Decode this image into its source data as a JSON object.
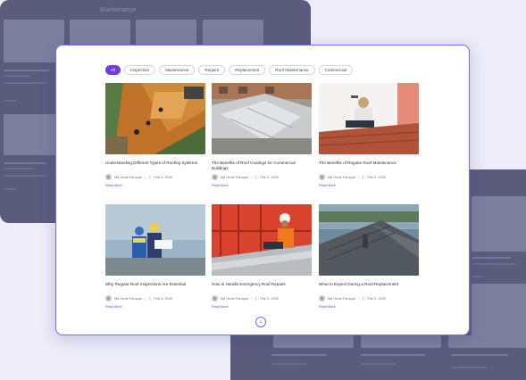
{
  "background": {
    "left_title": "Maintenance",
    "left_posts": [
      {
        "title": "Understanding Different Types of Roofing Systems"
      },
      {
        "title": "What to Expect During a Roof Replacement"
      }
    ],
    "right_posts": [
      {
        "title": "Understanding Different Types of Roofing Systems"
      },
      {
        "title": "The Benefits of Roof Coatings for Commercial Buildings"
      },
      {
        "title": "The Benefits of Regular Roof Maintenance"
      }
    ]
  },
  "filters": [
    "All",
    "Inspection",
    "Maintenance",
    "Repairs",
    "Replacement",
    "Roof Maintenance",
    "Commercial"
  ],
  "active_filter": "All",
  "posts": [
    {
      "title": "Understanding Different Types of Roofing Systems",
      "author": "Md Omar Faruque",
      "date": "Feb 3, 2025",
      "link": "Read More",
      "image": "aerial-roof-icon"
    },
    {
      "title": "The Benefits of Roof Coatings for Commercial Buildings",
      "author": "Md Omar Faruque",
      "date": "Feb 3, 2025",
      "link": "Read More",
      "image": "commercial-roof-icon"
    },
    {
      "title": "The Benefits of Regular Roof Maintenance",
      "author": "Md Omar Faruque",
      "date": "Feb 3, 2025",
      "link": "Read More",
      "image": "roofer-tiles-icon"
    },
    {
      "title": "Why Regular Roof Inspections Are Essential",
      "author": "Md Omar Faruque",
      "date": "Feb 3, 2025",
      "link": "Read More",
      "image": "inspectors-icon"
    },
    {
      "title": "How to Handle Emergency Roof Repairs",
      "author": "Md Omar Faruque",
      "date": "Feb 3, 2025",
      "link": "Read More",
      "image": "worker-roof-icon"
    },
    {
      "title": "What to Expect During a Roof Replacement",
      "author": "Md Omar Faruque",
      "date": "Feb 3, 2025",
      "link": "Read More",
      "image": "shingle-roof-icon"
    }
  ],
  "pagination": {
    "current": "1"
  },
  "colors": {
    "accent": "#6b3fe0",
    "panel_border": "#6d6ff0",
    "backdrop": "#5b5c7c"
  }
}
